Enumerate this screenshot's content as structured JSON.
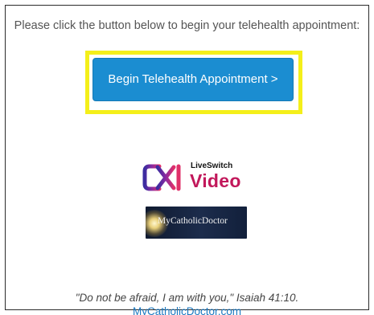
{
  "intro_text": "Please click the button below to begin your telehealth appointment:",
  "cta_button": {
    "label": "Begin Telehealth Appointment >"
  },
  "liveswitch_logo": {
    "brand": "LiveSwitch",
    "product": "Video"
  },
  "mcd_logo": {
    "text": "MyCatholicDoctor"
  },
  "footer": {
    "quote": "\"Do not be afraid, I am with you,\" Isaiah 41:10.",
    "site_link": "MyCatholicDoctor.com"
  },
  "colors": {
    "highlight": "#f4ef1a",
    "button": "#1b8dd1",
    "link": "#1b79c1",
    "liveswitch_magenta": "#c2185b",
    "liveswitch_purple": "#5b2d90"
  }
}
